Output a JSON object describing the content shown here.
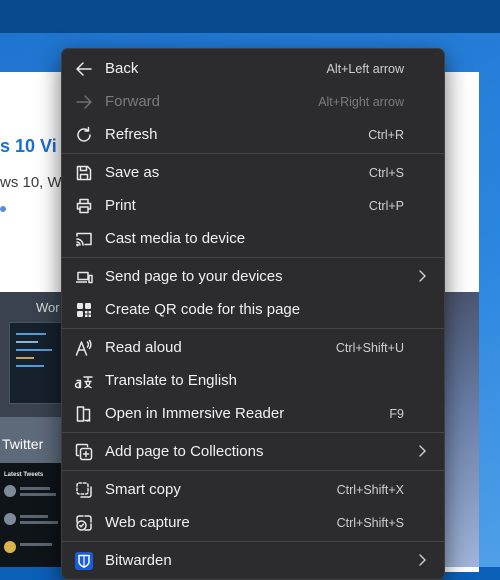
{
  "background": {
    "article_title_fragment": "s 10 Vi",
    "article_subtitle_fragment": "ws 10, W",
    "strip_label": "Wor",
    "twitter_label": "Twitter",
    "tweets_header": "Latest Tweets"
  },
  "menu": {
    "items": [
      {
        "label": "Back",
        "shortcut": "Alt+Left arrow",
        "icon": "back-arrow-icon",
        "enabled": true
      },
      {
        "label": "Forward",
        "shortcut": "Alt+Right arrow",
        "icon": "forward-arrow-icon",
        "enabled": false
      },
      {
        "label": "Refresh",
        "shortcut": "Ctrl+R",
        "icon": "refresh-icon",
        "enabled": true
      },
      {
        "label": "Save as",
        "shortcut": "Ctrl+S",
        "icon": "save-icon",
        "enabled": true
      },
      {
        "label": "Print",
        "shortcut": "Ctrl+P",
        "icon": "print-icon",
        "enabled": true
      },
      {
        "label": "Cast media to device",
        "shortcut": "",
        "icon": "cast-icon",
        "enabled": true
      },
      {
        "label": "Send page to your devices",
        "shortcut": "",
        "icon": "devices-icon",
        "submenu": true,
        "enabled": true
      },
      {
        "label": "Create QR code for this page",
        "shortcut": "",
        "icon": "qr-code-icon",
        "enabled": true
      },
      {
        "label": "Read aloud",
        "shortcut": "Ctrl+Shift+U",
        "icon": "read-aloud-icon",
        "enabled": true
      },
      {
        "label": "Translate to English",
        "shortcut": "",
        "icon": "translate-icon",
        "enabled": true
      },
      {
        "label": "Open in Immersive Reader",
        "shortcut": "F9",
        "icon": "immersive-reader-icon",
        "enabled": true
      },
      {
        "label": "Add page to Collections",
        "shortcut": "",
        "icon": "collections-icon",
        "submenu": true,
        "enabled": true
      },
      {
        "label": "Smart copy",
        "shortcut": "Ctrl+Shift+X",
        "icon": "smart-copy-icon",
        "enabled": true
      },
      {
        "label": "Web capture",
        "shortcut": "Ctrl+Shift+S",
        "icon": "web-capture-icon",
        "enabled": true
      },
      {
        "label": "Bitwarden",
        "shortcut": "",
        "icon": "bitwarden-icon",
        "submenu": true,
        "enabled": true
      }
    ]
  },
  "colors": {
    "menu_background": "#2c2c2e",
    "menu_text": "#f1f1f1",
    "disabled_text": "#7b7b7e",
    "page_blue": "#1f74cf",
    "bitwarden_blue": "#175ddc"
  }
}
